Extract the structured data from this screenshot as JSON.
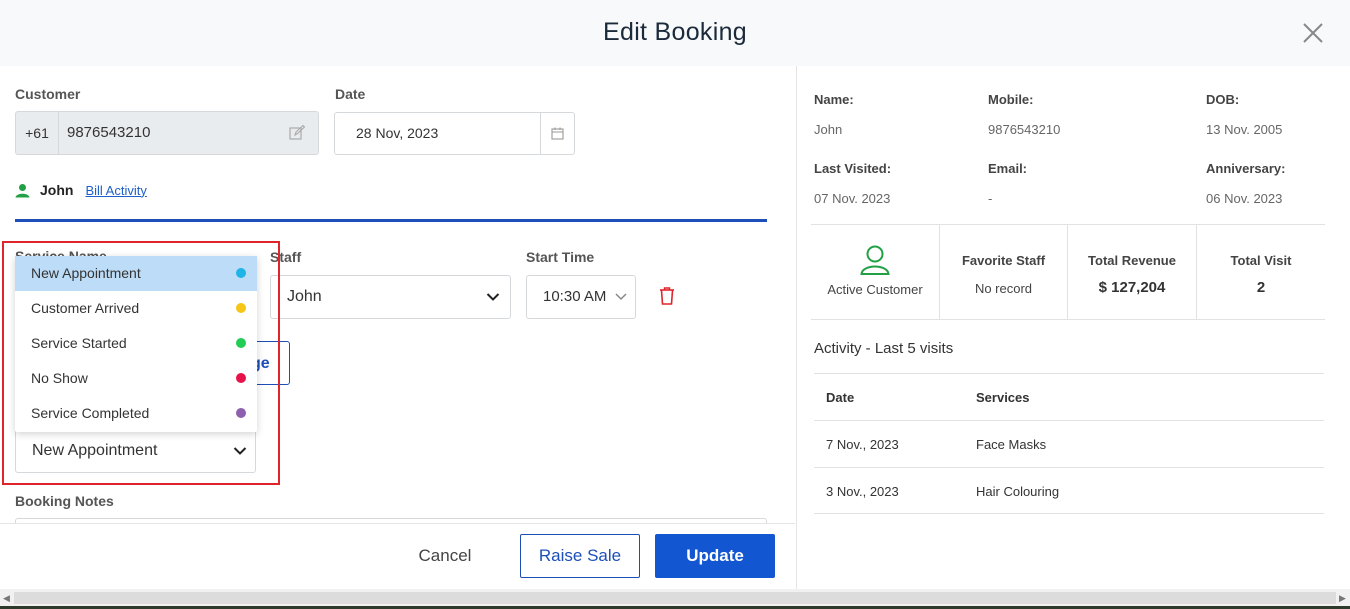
{
  "header": {
    "title": "Edit Booking"
  },
  "form": {
    "customer_label": "Customer",
    "phone_code": "+61",
    "phone_number": "9876543210",
    "date_label": "Date",
    "date_value": "28 Nov, 2023",
    "customer_name": "John",
    "bill_activity_link": "Bill Activity",
    "service_name_label": "Service Name",
    "staff_label": "Staff",
    "staff_value": "John",
    "start_time_label": "Start Time",
    "start_time_value": "10:30 AM",
    "partial_button_label": "ge",
    "status_value": "New Appointment",
    "booking_notes_label": "Booking Notes"
  },
  "status_dropdown": {
    "items": [
      {
        "label": "New Appointment",
        "color": "#1fb4e6",
        "selected": true
      },
      {
        "label": "Customer Arrived",
        "color": "#f5c518",
        "selected": false
      },
      {
        "label": "Service Started",
        "color": "#22cc55",
        "selected": false
      },
      {
        "label": "No Show",
        "color": "#e8124a",
        "selected": false
      },
      {
        "label": "Service Completed",
        "color": "#8e5fae",
        "selected": false
      }
    ]
  },
  "footer": {
    "cancel": "Cancel",
    "raise_sale": "Raise Sale",
    "update": "Update"
  },
  "customer_info": {
    "name_label": "Name:",
    "name_value": "John",
    "mobile_label": "Mobile:",
    "mobile_value": "9876543210",
    "dob_label": "DOB:",
    "dob_value": "13 Nov. 2005",
    "last_visited_label": "Last Visited:",
    "last_visited_value": "07 Nov. 2023",
    "email_label": "Email:",
    "email_value": "-",
    "anniversary_label": "Anniversary:",
    "anniversary_value": "06 Nov. 2023"
  },
  "stats": {
    "active_customer": "Active Customer",
    "favorite_staff_label": "Favorite Staff",
    "favorite_staff_value": "No record",
    "total_revenue_label": "Total Revenue",
    "total_revenue_value": "$ 127,204",
    "total_visit_label": "Total Visit",
    "total_visit_value": "2"
  },
  "activity": {
    "title": "Activity - Last 5 visits",
    "col_date": "Date",
    "col_services": "Services",
    "rows": [
      {
        "date": "7 Nov., 2023",
        "service": "Face Masks"
      },
      {
        "date": "3 Nov., 2023",
        "service": "Hair Colouring"
      }
    ]
  },
  "colors": {
    "primary": "#1256d1",
    "highlight_border": "#e0242b",
    "icon_green": "#22a045"
  },
  "icons": [
    "close-icon",
    "edit-icon",
    "calendar-icon",
    "user-icon",
    "chevron-down-icon",
    "trash-icon",
    "user-outline-icon"
  ]
}
